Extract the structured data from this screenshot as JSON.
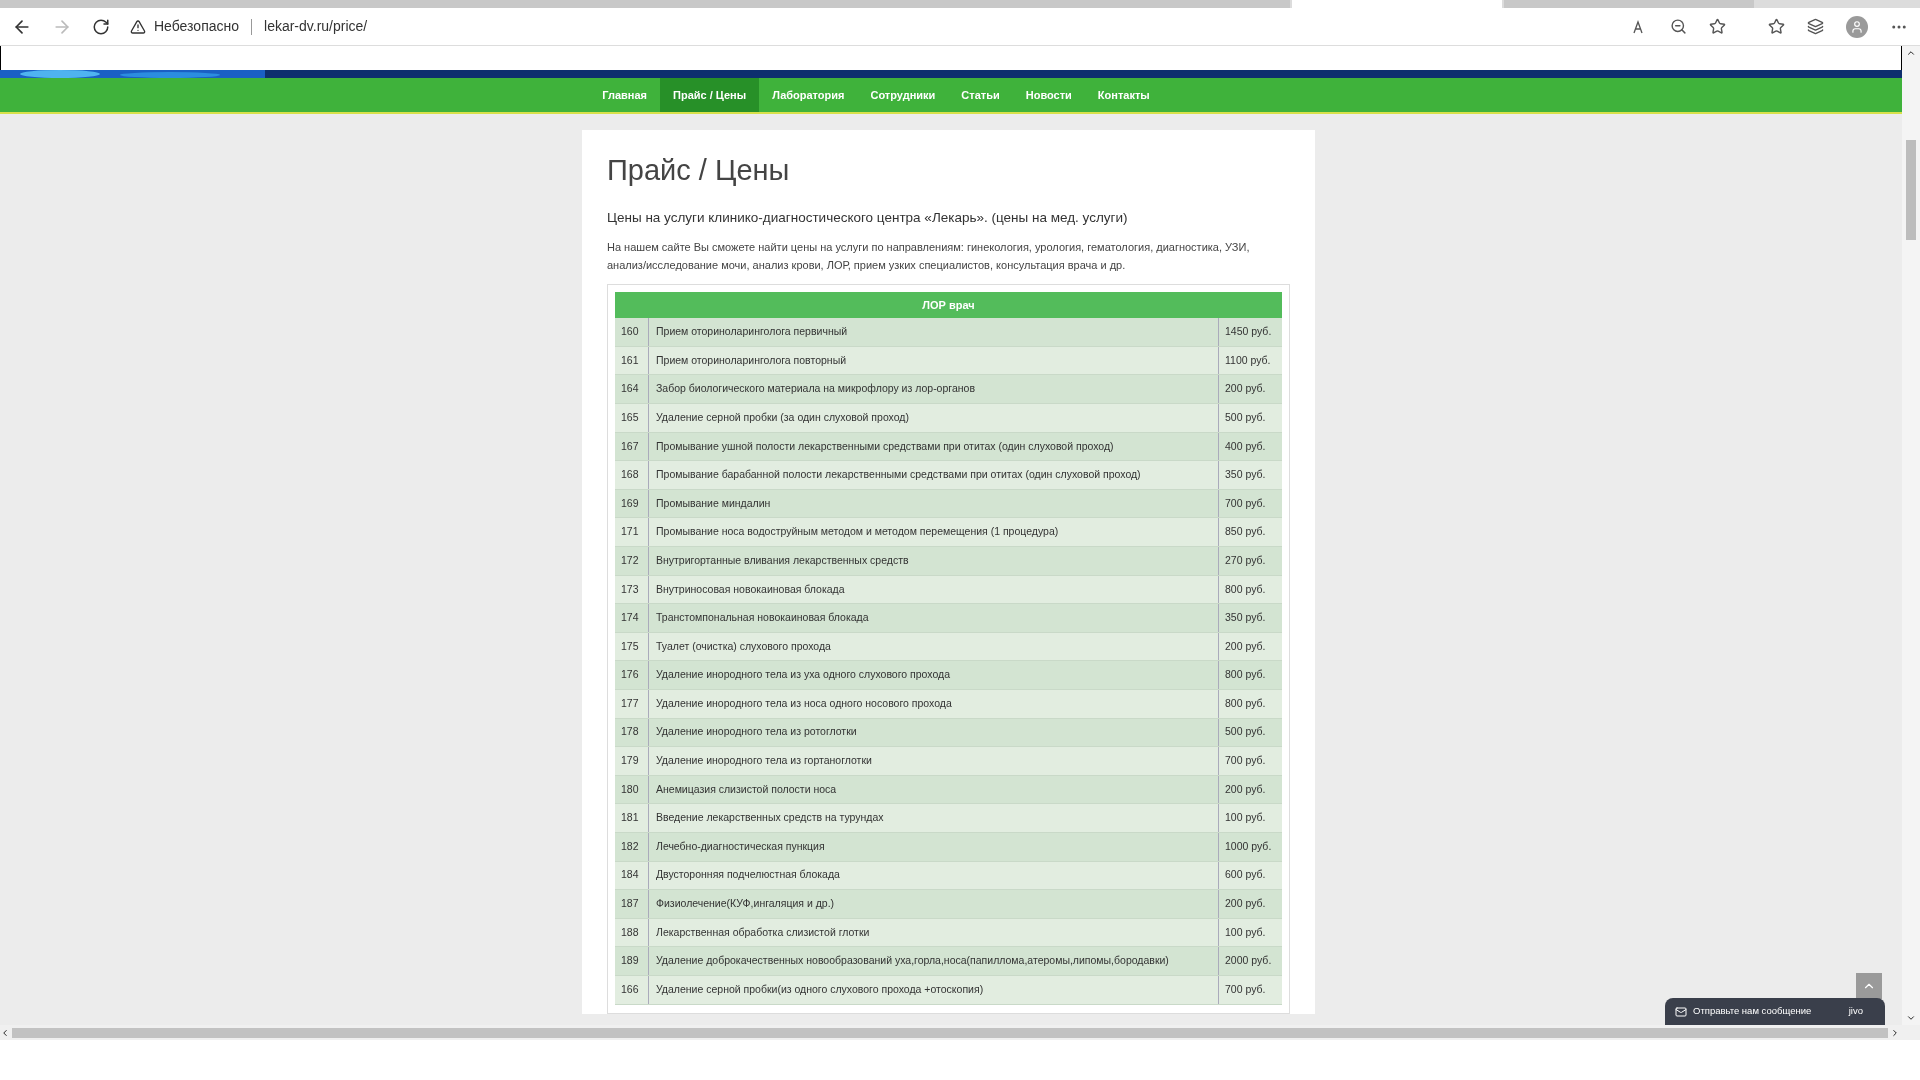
{
  "browser": {
    "security": "Небезопасно",
    "url": "lekar-dv.ru/price/"
  },
  "nav": [
    {
      "label": "Главная",
      "selected": false
    },
    {
      "label": "Прайс / Цены",
      "selected": true
    },
    {
      "label": "Лаборатория",
      "selected": false
    },
    {
      "label": "Сотрудники",
      "selected": false
    },
    {
      "label": "Статьи",
      "selected": false
    },
    {
      "label": "Новости",
      "selected": false
    },
    {
      "label": "Контакты",
      "selected": false
    }
  ],
  "page": {
    "title": "Прайс / Цены",
    "subtitle": "Цены на услуги клинико-диагностического центра «Лекарь». (цены на мед. услуги)",
    "intro": "На нашем сайте Вы сможете найти цены на услуги по направлениям: гинекология, урология, гематология, диагностика, УЗИ, анализ/исследование мочи, анализ крови, ЛОР, прием узких специалистов, консультация врача и др."
  },
  "table": {
    "heading": "ЛОР врач",
    "rows": [
      {
        "code": "160",
        "service": "Прием оториноларинголога первичный",
        "price": "1450 руб."
      },
      {
        "code": "161",
        "service": "Прием оториноларинголога повторный",
        "price": "1100 руб."
      },
      {
        "code": "164",
        "service": "Забор биологического материала на микрофлору из лор-органов",
        "price": "200 руб."
      },
      {
        "code": "165",
        "service": "Удаление серной пробки (за один слуховой проход)",
        "price": "500 руб."
      },
      {
        "code": "167",
        "service": "Промывание ушной полости лекарственными средствами при отитах (один слуховой проход)",
        "price": "400 руб."
      },
      {
        "code": "168",
        "service": "Промывание барабанной полости лекарственными средствами при отитах (один слуховой проход)",
        "price": "350 руб."
      },
      {
        "code": "169",
        "service": "Промывание миндалин",
        "price": "700 руб."
      },
      {
        "code": "171",
        "service": "Промывание носа водоструйным методом и методом перемещения (1 процедура)",
        "price": "850 руб."
      },
      {
        "code": "172",
        "service": "Внутригортанные вливания лекарственных средств",
        "price": "270 руб."
      },
      {
        "code": "173",
        "service": "Внутриносовая новокаиновая блокада",
        "price": "800 руб."
      },
      {
        "code": "174",
        "service": "Транстомпональная новокаиновая блокада",
        "price": "350 руб."
      },
      {
        "code": "175",
        "service": "Туалет (очистка) слухового прохода",
        "price": "200 руб."
      },
      {
        "code": "176",
        "service": "Удаление инородного тела из уха одного слухового прохода",
        "price": "800 руб."
      },
      {
        "code": "177",
        "service": "Удаление инородного тела из носа одного носового прохода",
        "price": "800 руб."
      },
      {
        "code": "178",
        "service": "Удаление инородного тела из ротоглотки",
        "price": "500 руб."
      },
      {
        "code": "179",
        "service": "Удаление инородного тела из гортаноглотки",
        "price": "700 руб."
      },
      {
        "code": "180",
        "service": "Анемицазия слизистой полости носа",
        "price": "200 руб."
      },
      {
        "code": "181",
        "service": "Введение лекарственных средств на турундах",
        "price": "100 руб."
      },
      {
        "code": "182",
        "service": "Лечебно-диагностическая пункция",
        "price": "1000 руб."
      },
      {
        "code": "184",
        "service": "Двусторонняя подчелюстная блокада",
        "price": "600 руб."
      },
      {
        "code": "187",
        "service": "Физиолечение(КУФ,ингаляция и др.)",
        "price": "200 руб."
      },
      {
        "code": "188",
        "service": "Лекарственная обработка слизистой глотки",
        "price": "100 руб."
      },
      {
        "code": "189",
        "service": "Удаление доброкачественных новообразований уха,горла,носа(папиллома,атеромы,липомы,бородавки)",
        "price": "2000 руб."
      },
      {
        "code": "166",
        "service": "Удаление серной пробки(из одного слухового прохода +отоскопия)",
        "price": "700 руб."
      }
    ]
  },
  "chat": {
    "label": "Отправьте нам сообщение",
    "brand": "jivo"
  }
}
